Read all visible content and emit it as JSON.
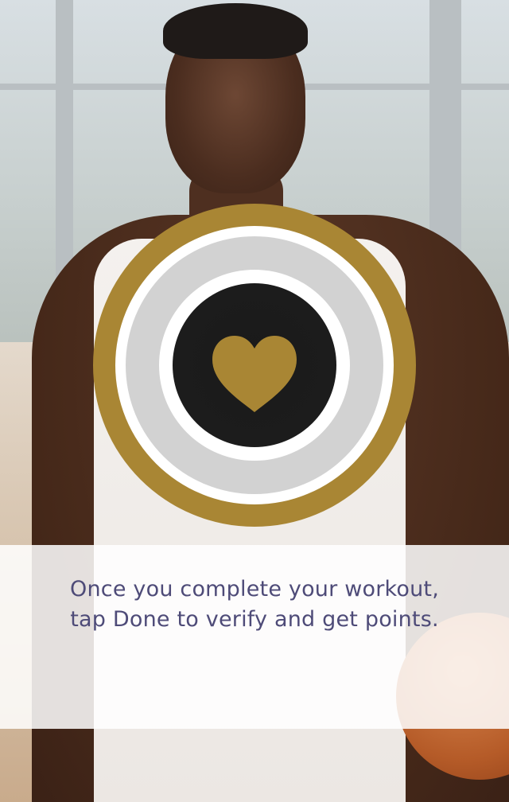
{
  "caption": {
    "line1": "Once you complete your workout,",
    "line2": "tap Done to verify and get points."
  },
  "colors": {
    "accent_gold": "#a98634",
    "caption_text": "#4e4b78",
    "button_core": "#1c1c1c"
  },
  "icons": {
    "center": "heart-icon"
  }
}
